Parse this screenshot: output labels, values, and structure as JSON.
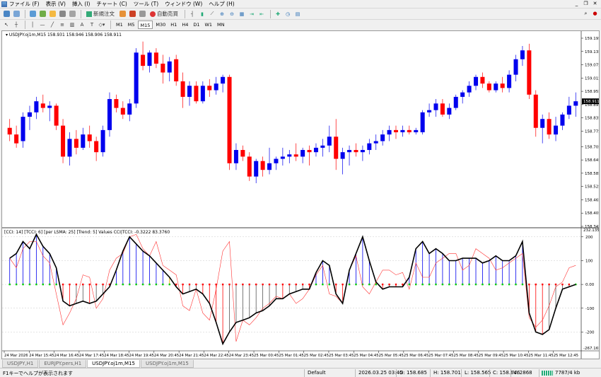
{
  "menu": [
    {
      "label": "ファイル (F)"
    },
    {
      "label": "表示 (V)"
    },
    {
      "label": "挿入 (I)"
    },
    {
      "label": "チャート (C)"
    },
    {
      "label": "ツール (T)"
    },
    {
      "label": "ウィンドウ (W)"
    },
    {
      "label": "ヘルプ (H)"
    }
  ],
  "toolbar": {
    "new_order": "新規注文",
    "auto_trade": "自動売買"
  },
  "timeframes": [
    "M1",
    "M5",
    "M15",
    "M30",
    "H1",
    "H4",
    "D1",
    "W1",
    "MN"
  ],
  "active_timeframe": "M15",
  "chart": {
    "title": "USDJPY.oj1m,M15  158.931 158.946 158.906 158.911",
    "current_price_label": "158.911",
    "price_ticks": [
      "159.195",
      "159.135",
      "159.075",
      "159.015",
      "158.955",
      "158.895",
      "158.835",
      "158.775",
      "158.705",
      "158.645",
      "158.585",
      "158.525",
      "158.465",
      "158.405",
      "158.345"
    ],
    "time_ticks": [
      "24 Mar 2026",
      "24 Mar 15:45",
      "24 Mar 16:45",
      "24 Mar 17:45",
      "24 Mar 18:45",
      "24 Mar 19:45",
      "24 Mar 20:45",
      "24 Mar 21:45",
      "24 Mar 22:45",
      "24 Mar 23:45",
      "25 Mar 00:45",
      "25 Mar 01:45",
      "25 Mar 02:45",
      "25 Mar 03:45",
      "25 Mar 04:45",
      "25 Mar 05:45",
      "25 Mar 06:45",
      "25 Mar 07:45",
      "25 Mar 08:45",
      "25 Mar 09:45",
      "25 Mar 10:45",
      "25 Mar 11:45",
      "25 Mar 12:45"
    ]
  },
  "indicator": {
    "title": "[CCI: 14] [TCCI: 6] [per LSMA: 25] [Trend: 5] Values CCI|TCCI: -0.3222 83.3760",
    "scale_top": "232.1358",
    "scale_bottom": "-267.1651",
    "ticks": [
      "200",
      "100",
      "0.00",
      "-100",
      "-200"
    ]
  },
  "tabs": [
    {
      "label": "USDJPY,H1",
      "active": false
    },
    {
      "label": "EURJPY.pers,H1",
      "active": false
    },
    {
      "label": "USDJPY.oj1m,M15",
      "active": true
    },
    {
      "label": "USDJPY.oj1m,M15",
      "active": false
    }
  ],
  "status": {
    "help": "F1キーでヘルプが表示されます",
    "profile": "Default",
    "datetime": "2026.03.25 03:45",
    "open": "O: 158.685",
    "high": "H: 158.701",
    "low": "L: 158.565",
    "close": "C: 158.646",
    "volume": "V: 2868",
    "traffic": "7787/4 kb"
  },
  "chart_data": {
    "type": "candlestick",
    "series": [
      {
        "name": "USDJPY.oj1m,M15",
        "ohlc": [
          [
            158.79,
            158.83,
            158.73,
            158.76
          ],
          [
            158.76,
            158.8,
            158.7,
            158.72
          ],
          [
            158.73,
            158.86,
            158.7,
            158.84
          ],
          [
            158.84,
            158.89,
            158.78,
            158.86
          ],
          [
            158.86,
            158.93,
            158.83,
            158.91
          ],
          [
            158.9,
            158.94,
            158.86,
            158.88
          ],
          [
            158.88,
            158.91,
            158.82,
            158.89
          ],
          [
            158.89,
            158.9,
            158.78,
            158.8
          ],
          [
            158.8,
            158.83,
            158.63,
            158.66
          ],
          [
            158.66,
            158.77,
            158.62,
            158.74
          ],
          [
            158.74,
            158.78,
            158.67,
            158.7
          ],
          [
            158.7,
            158.79,
            158.69,
            158.76
          ],
          [
            158.76,
            158.8,
            158.7,
            158.73
          ],
          [
            158.73,
            158.75,
            158.64,
            158.68
          ],
          [
            158.68,
            158.8,
            158.66,
            158.78
          ],
          [
            158.78,
            158.95,
            158.75,
            158.92
          ],
          [
            158.92,
            158.94,
            158.86,
            158.88
          ],
          [
            158.88,
            158.91,
            158.83,
            158.85
          ],
          [
            158.85,
            158.92,
            158.82,
            158.9
          ],
          [
            158.9,
            159.15,
            158.88,
            159.13
          ],
          [
            159.12,
            159.18,
            159.05,
            159.07
          ],
          [
            159.07,
            159.14,
            159.04,
            159.13
          ],
          [
            159.13,
            159.15,
            159.06,
            159.08
          ],
          [
            159.08,
            159.12,
            158.99,
            159.04
          ],
          [
            159.04,
            159.11,
            159.0,
            159.09
          ],
          [
            159.1,
            159.12,
            158.98,
            159.0
          ],
          [
            159.0,
            159.04,
            158.88,
            158.93
          ],
          [
            158.93,
            159.0,
            158.89,
            158.98
          ],
          [
            158.98,
            159.0,
            158.9,
            158.91
          ],
          [
            158.91,
            159.0,
            158.9,
            158.98
          ],
          [
            158.98,
            159.01,
            158.93,
            158.96
          ],
          [
            158.96,
            159.02,
            158.94,
            158.99
          ],
          [
            158.99,
            159.03,
            158.95,
            159.02
          ],
          [
            159.02,
            159.03,
            158.6,
            158.63
          ],
          [
            158.63,
            158.72,
            158.6,
            158.69
          ],
          [
            158.69,
            158.71,
            158.64,
            158.66
          ],
          [
            158.66,
            158.68,
            158.55,
            158.57
          ],
          [
            158.57,
            158.65,
            158.54,
            158.64
          ],
          [
            158.64,
            158.66,
            158.57,
            158.6
          ],
          [
            158.6,
            158.7,
            158.58,
            158.63
          ],
          [
            158.63,
            158.66,
            158.6,
            158.65
          ],
          [
            158.65,
            158.7,
            158.62,
            158.66
          ],
          [
            158.66,
            158.69,
            158.63,
            158.67
          ],
          [
            158.67,
            158.72,
            158.64,
            158.66
          ],
          [
            158.66,
            158.7,
            158.63,
            158.69
          ],
          [
            158.69,
            158.71,
            158.62,
            158.68
          ],
          [
            158.68,
            158.72,
            158.66,
            158.7
          ],
          [
            158.7,
            158.74,
            158.66,
            158.71
          ],
          [
            158.71,
            158.8,
            158.68,
            158.75
          ],
          [
            158.75,
            158.83,
            158.6,
            158.65
          ],
          [
            158.65,
            158.7,
            158.58,
            158.68
          ],
          [
            158.68,
            158.71,
            158.62,
            158.69
          ],
          [
            158.69,
            158.72,
            158.66,
            158.68
          ],
          [
            158.68,
            158.71,
            158.64,
            158.69
          ],
          [
            158.69,
            158.74,
            158.67,
            158.72
          ],
          [
            158.72,
            158.76,
            158.69,
            158.73
          ],
          [
            158.73,
            158.78,
            158.71,
            158.76
          ],
          [
            158.76,
            158.8,
            158.73,
            158.78
          ],
          [
            158.78,
            158.8,
            158.74,
            158.77
          ],
          [
            158.77,
            158.8,
            158.75,
            158.78
          ],
          [
            158.78,
            158.8,
            158.76,
            158.77
          ],
          [
            158.77,
            158.79,
            158.76,
            158.78
          ],
          [
            158.77,
            158.87,
            158.76,
            158.86
          ],
          [
            158.86,
            158.9,
            158.84,
            158.87
          ],
          [
            158.87,
            158.92,
            158.84,
            158.9
          ],
          [
            158.9,
            158.92,
            158.84,
            158.85
          ],
          [
            158.85,
            158.9,
            158.83,
            158.88
          ],
          [
            158.88,
            158.94,
            158.87,
            158.93
          ],
          [
            158.93,
            158.96,
            158.9,
            158.95
          ],
          [
            158.95,
            159.0,
            158.93,
            158.98
          ],
          [
            158.98,
            159.03,
            158.96,
            159.02
          ],
          [
            159.02,
            159.04,
            158.97,
            158.99
          ],
          [
            158.99,
            159.0,
            158.95,
            158.96
          ],
          [
            158.96,
            159.0,
            158.95,
            158.99
          ],
          [
            158.99,
            159.02,
            158.95,
            158.97
          ],
          [
            158.97,
            159.05,
            158.95,
            159.03
          ],
          [
            159.03,
            159.12,
            159.0,
            159.1
          ],
          [
            159.1,
            159.16,
            159.07,
            159.14
          ],
          [
            159.14,
            159.17,
            158.92,
            158.94
          ],
          [
            158.94,
            158.96,
            158.75,
            158.79
          ],
          [
            158.79,
            158.85,
            158.72,
            158.83
          ],
          [
            158.83,
            158.86,
            158.74,
            158.76
          ],
          [
            158.76,
            158.84,
            158.73,
            158.8
          ],
          [
            158.8,
            158.86,
            158.78,
            158.85
          ],
          [
            158.85,
            158.93,
            158.83,
            158.89
          ],
          [
            158.89,
            158.95,
            158.84,
            158.91
          ]
        ]
      }
    ],
    "indicator_series": [
      {
        "name": "CCI",
        "values": [
          110,
          70,
          150,
          180,
          180,
          120,
          90,
          -40,
          -170,
          -120,
          -60,
          40,
          30,
          -100,
          -60,
          60,
          110,
          130,
          200,
          210,
          150,
          120,
          180,
          80,
          60,
          40,
          -90,
          -110,
          -20,
          -120,
          -150,
          -20,
          140,
          180,
          -240,
          -150,
          -170,
          -140,
          -100,
          -80,
          -50,
          -60,
          -40,
          -80,
          -60,
          -20,
          40,
          80,
          -40,
          -50,
          -80,
          60,
          120,
          -10,
          -40,
          10,
          60,
          60,
          40,
          50,
          -20,
          90,
          30,
          30,
          90,
          110,
          130,
          130,
          60,
          80,
          150,
          130,
          110,
          60,
          70,
          90,
          110,
          130,
          -140,
          -180,
          -150,
          -90,
          -10,
          10,
          70,
          80
        ]
      },
      {
        "name": "TCCI",
        "values": [
          110,
          130,
          180,
          150,
          210,
          160,
          130,
          70,
          -70,
          -90,
          -80,
          -70,
          -80,
          -70,
          -40,
          -10,
          60,
          140,
          200,
          170,
          140,
          120,
          90,
          60,
          30,
          -10,
          -40,
          -30,
          -20,
          -40,
          -80,
          -160,
          -250,
          -200,
          -160,
          -150,
          -140,
          -120,
          -110,
          -90,
          -60,
          -60,
          -40,
          -30,
          -20,
          -20,
          50,
          100,
          80,
          -40,
          -80,
          60,
          130,
          200,
          100,
          10,
          -20,
          -10,
          -10,
          -10,
          30,
          150,
          180,
          130,
          150,
          130,
          100,
          100,
          110,
          110,
          110,
          90,
          100,
          120,
          100,
          100,
          120,
          180,
          -120,
          -200,
          -210,
          -190,
          -100,
          -20,
          -10,
          0
        ]
      }
    ],
    "ylim": [
      158.345,
      159.195
    ],
    "indicator_ylim": [
      -267.1651,
      232.1358
    ]
  }
}
